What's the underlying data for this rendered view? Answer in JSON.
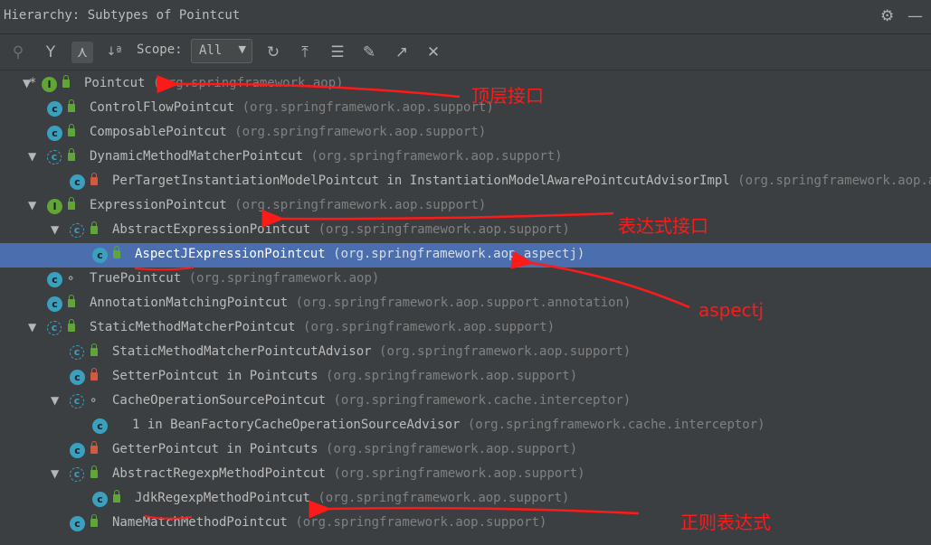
{
  "title": "Hierarchy: Subtypes of Pointcut",
  "toolbar": {
    "scope_label": "Scope:",
    "scope_value": "All",
    "icons": [
      "subtypes-hierarchy-icon",
      "supertypes-hierarchy-icon",
      "class-hierarchy-icon",
      "sort-alphabetically-icon",
      "refresh-icon",
      "export-icon",
      "expand-all-icon",
      "pin-icon",
      "open-in-editor-icon",
      "close-icon"
    ]
  },
  "window_controls": {
    "settings": "gear-icon",
    "minimize": "minimize-icon"
  },
  "tree": [
    {
      "name": "Pointcut",
      "pkg": "(org.springframework.aop)",
      "indent": 0,
      "toggle": "expanded",
      "kind": "interface",
      "access": "public",
      "star": true
    },
    {
      "name": "ControlFlowPointcut",
      "pkg": "(org.springframework.aop.support)",
      "indent": 1,
      "toggle": "none",
      "kind": "class",
      "access": "public"
    },
    {
      "name": "ComposablePointcut",
      "pkg": "(org.springframework.aop.support)",
      "indent": 1,
      "toggle": "none",
      "kind": "class",
      "access": "public"
    },
    {
      "name": "DynamicMethodMatcherPointcut",
      "pkg": "(org.springframework.aop.support)",
      "indent": 1,
      "toggle": "expanded",
      "kind": "abstract",
      "access": "public"
    },
    {
      "name": "PerTargetInstantiationModelPointcut in InstantiationModelAwarePointcutAdvisorImpl",
      "pkg": "(org.springframework.aop.aspectj.annotation)",
      "indent": 2,
      "toggle": "none",
      "kind": "class",
      "access": "private"
    },
    {
      "name": "ExpressionPointcut",
      "pkg": "(org.springframework.aop.support)",
      "indent": 1,
      "toggle": "expanded",
      "kind": "interface",
      "access": "public"
    },
    {
      "name": "AbstractExpressionPointcut",
      "pkg": "(org.springframework.aop.support)",
      "indent": 2,
      "toggle": "expanded",
      "kind": "abstract",
      "access": "public"
    },
    {
      "name": "AspectJExpressionPointcut",
      "pkg": "(org.springframework.aop.aspectj)",
      "indent": 3,
      "toggle": "none",
      "kind": "class",
      "access": "public",
      "selected": true
    },
    {
      "name": "TruePointcut",
      "pkg": "(org.springframework.aop)",
      "indent": 1,
      "toggle": "none",
      "kind": "class",
      "access": "package"
    },
    {
      "name": "AnnotationMatchingPointcut",
      "pkg": "(org.springframework.aop.support.annotation)",
      "indent": 1,
      "toggle": "none",
      "kind": "class",
      "access": "public"
    },
    {
      "name": "StaticMethodMatcherPointcut",
      "pkg": "(org.springframework.aop.support)",
      "indent": 1,
      "toggle": "expanded",
      "kind": "abstract",
      "access": "public"
    },
    {
      "name": "StaticMethodMatcherPointcutAdvisor",
      "pkg": "(org.springframework.aop.support)",
      "indent": 2,
      "toggle": "none",
      "kind": "abstract",
      "access": "public"
    },
    {
      "name": "SetterPointcut in Pointcuts",
      "pkg": "(org.springframework.aop.support)",
      "indent": 2,
      "toggle": "none",
      "kind": "class",
      "access": "private"
    },
    {
      "name": "CacheOperationSourcePointcut",
      "pkg": "(org.springframework.cache.interceptor)",
      "indent": 2,
      "toggle": "expanded",
      "kind": "abstract",
      "access": "package"
    },
    {
      "name": "1 in BeanFactoryCacheOperationSourceAdvisor",
      "pkg": "(org.springframework.cache.interceptor)",
      "indent": 3,
      "toggle": "none",
      "kind": "class",
      "access": "none"
    },
    {
      "name": "GetterPointcut in Pointcuts",
      "pkg": "(org.springframework.aop.support)",
      "indent": 2,
      "toggle": "none",
      "kind": "class",
      "access": "private"
    },
    {
      "name": "AbstractRegexpMethodPointcut",
      "pkg": "(org.springframework.aop.support)",
      "indent": 2,
      "toggle": "expanded",
      "kind": "abstract",
      "access": "public"
    },
    {
      "name": "JdkRegexpMethodPointcut",
      "pkg": "(org.springframework.aop.support)",
      "indent": 3,
      "toggle": "none",
      "kind": "class",
      "access": "public"
    },
    {
      "name": "NameMatchMethodPointcut",
      "pkg": "(org.springframework.aop.support)",
      "indent": 2,
      "toggle": "none",
      "kind": "class",
      "access": "public"
    }
  ],
  "annotations": {
    "top_interface": "顶层接口",
    "expression_interface": "表达式接口",
    "aspectj": "aspectj",
    "regex": "正则表达式"
  },
  "colors": {
    "background": "#3c3f41",
    "selection": "#4b6eaf",
    "annotation": "#ff1a1a",
    "class_icon": "#3aa0c0",
    "interface_icon": "#5fa538"
  }
}
